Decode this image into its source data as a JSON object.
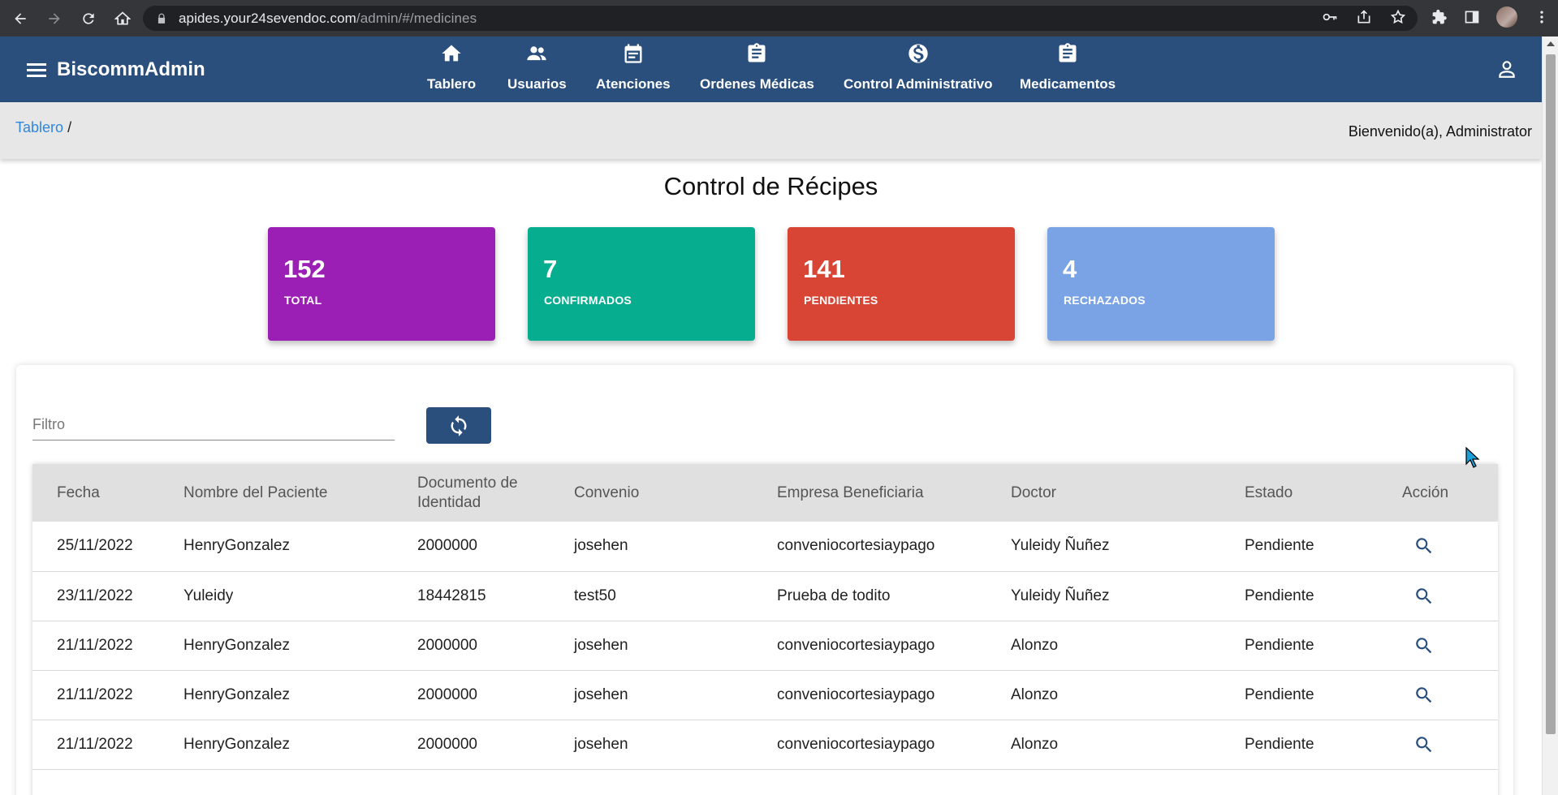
{
  "browser": {
    "url_host": "apides.your24sevendoc.com",
    "url_path": "/admin/#/medicines"
  },
  "app": {
    "brand": "BiscommAdmin",
    "nav": [
      {
        "label": "Tablero",
        "icon": "home-icon"
      },
      {
        "label": "Usuarios",
        "icon": "people-icon"
      },
      {
        "label": "Atenciones",
        "icon": "calendar-icon"
      },
      {
        "label": "Ordenes Médicas",
        "icon": "clipboard-icon"
      },
      {
        "label": "Control Administrativo",
        "icon": "dollar-icon"
      },
      {
        "label": "Medicamentos",
        "icon": "clipboard-icon"
      }
    ]
  },
  "breadcrumb": {
    "link": "Tablero",
    "separator": "/"
  },
  "welcome": "Bienvenido(a), Administrator",
  "page_title": "Control de Récipes",
  "stats": [
    {
      "value": "152",
      "label": "TOTAL",
      "color": "#9c1fb5"
    },
    {
      "value": "7",
      "label": "CONFIRMADOS",
      "color": "#07ad8f"
    },
    {
      "value": "141",
      "label": "PENDIENTES",
      "color": "#d94534"
    },
    {
      "value": "4",
      "label": "RECHAZADOS",
      "color": "#7aa3e5"
    }
  ],
  "filter": {
    "placeholder": "Filtro",
    "value": ""
  },
  "table": {
    "headers": [
      "Fecha",
      "Nombre del Paciente",
      "Documento de Identidad",
      "Convenio",
      "Empresa Beneficiaria",
      "Doctor",
      "Estado",
      "Acción"
    ],
    "rows": [
      [
        "25/11/2022",
        "HenryGonzalez",
        "2000000",
        "josehen",
        "conveniocortesiaypago",
        "Yuleidy Ñuñez",
        "Pendiente"
      ],
      [
        "23/11/2022",
        "Yuleidy",
        "18442815",
        "test50",
        "Prueba de todito",
        "Yuleidy Ñuñez",
        "Pendiente"
      ],
      [
        "21/11/2022",
        "HenryGonzalez",
        "2000000",
        "josehen",
        "conveniocortesiaypago",
        "Alonzo",
        "Pendiente"
      ],
      [
        "21/11/2022",
        "HenryGonzalez",
        "2000000",
        "josehen",
        "conveniocortesiaypago",
        "Alonzo",
        "Pendiente"
      ],
      [
        "21/11/2022",
        "HenryGonzalez",
        "2000000",
        "josehen",
        "conveniocortesiaypago",
        "Alonzo",
        "Pendiente"
      ]
    ]
  },
  "colors": {
    "appbar": "#2a4f7c",
    "link": "#2f86e0",
    "action_icon": "#2a4f7c"
  }
}
